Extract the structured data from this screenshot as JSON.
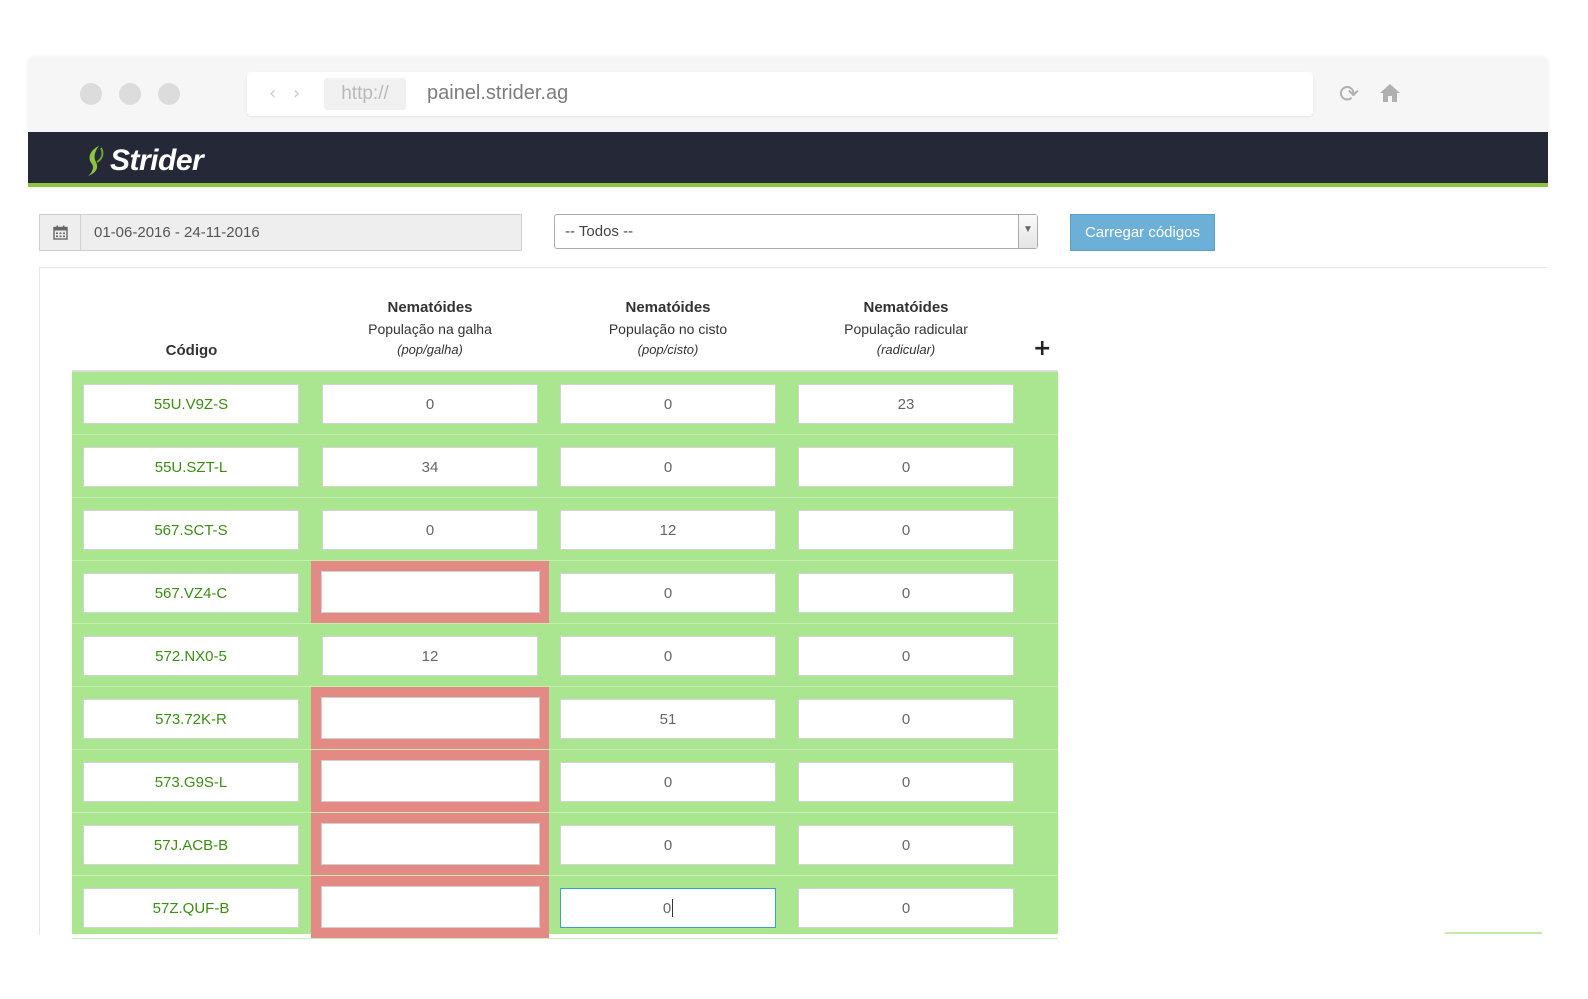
{
  "browser": {
    "protocol": "http://",
    "url": "painel.strider.ag"
  },
  "app": {
    "brand": "Strider",
    "accent_color": "#8cc63e",
    "header_color": "#252836"
  },
  "filters": {
    "date_range": "01-06-2016 - 24-11-2016",
    "select_value": "-- Todos --",
    "load_button": "Carregar códigos"
  },
  "table": {
    "code_header": "Código",
    "columns": [
      {
        "title": "Nematóides",
        "subtitle": "População na galha",
        "unit": "(pop/galha)"
      },
      {
        "title": "Nematóides",
        "subtitle": "População no cisto",
        "unit": "(pop/cisto)"
      },
      {
        "title": "Nematóides",
        "subtitle": "População radicular",
        "unit": "(radicular)"
      }
    ],
    "add_column": "+",
    "rows": [
      {
        "code": "55U.V9Z-S",
        "values": [
          "0",
          "0",
          "23"
        ]
      },
      {
        "code": "55U.SZT-L",
        "values": [
          "34",
          "0",
          "0"
        ]
      },
      {
        "code": "567.SCT-S",
        "values": [
          "0",
          "12",
          "0"
        ]
      },
      {
        "code": "567.VZ4-C",
        "values": [
          "",
          "0",
          "0"
        ]
      },
      {
        "code": "572.NX0-5",
        "values": [
          "12",
          "0",
          "0"
        ]
      },
      {
        "code": "573.72K-R",
        "values": [
          "",
          "51",
          "0"
        ]
      },
      {
        "code": "573.G9S-L",
        "values": [
          "",
          "0",
          "0"
        ]
      },
      {
        "code": "57J.ACB-B",
        "values": [
          "",
          "0",
          "0"
        ]
      },
      {
        "code": "57Z.QUF-B",
        "values": [
          "",
          "0",
          "0"
        ]
      }
    ],
    "colors": {
      "row_ok": "#aae68f",
      "cell_error": "#e38a85",
      "code_text": "#3c8d14"
    }
  }
}
